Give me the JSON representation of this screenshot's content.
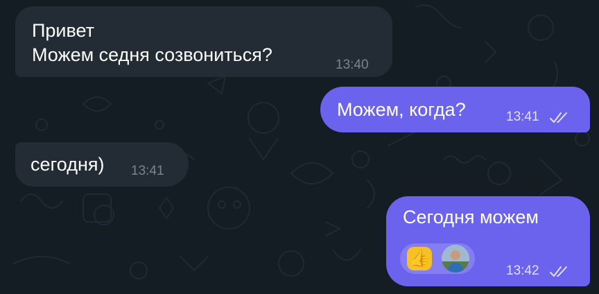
{
  "messages": [
    {
      "direction": "incoming",
      "lines": [
        "Привет",
        "Можем седня созвониться?"
      ],
      "time": "13:40"
    },
    {
      "direction": "outgoing",
      "text": "Можем, когда?",
      "time": "13:41",
      "status": "read"
    },
    {
      "direction": "incoming",
      "text": "сегодня)",
      "time": "13:41"
    },
    {
      "direction": "outgoing",
      "text": "Сегодня можем",
      "time": "13:42",
      "status": "read",
      "reaction": {
        "emoji": "👍",
        "icon": "thumbs-up-icon",
        "reactor": "avatar"
      }
    }
  ],
  "colors": {
    "background": "#141c24",
    "incoming_bubble": "#232b34",
    "outgoing_bubble": "#6b63ee",
    "reaction_pill": "#857ef2"
  }
}
